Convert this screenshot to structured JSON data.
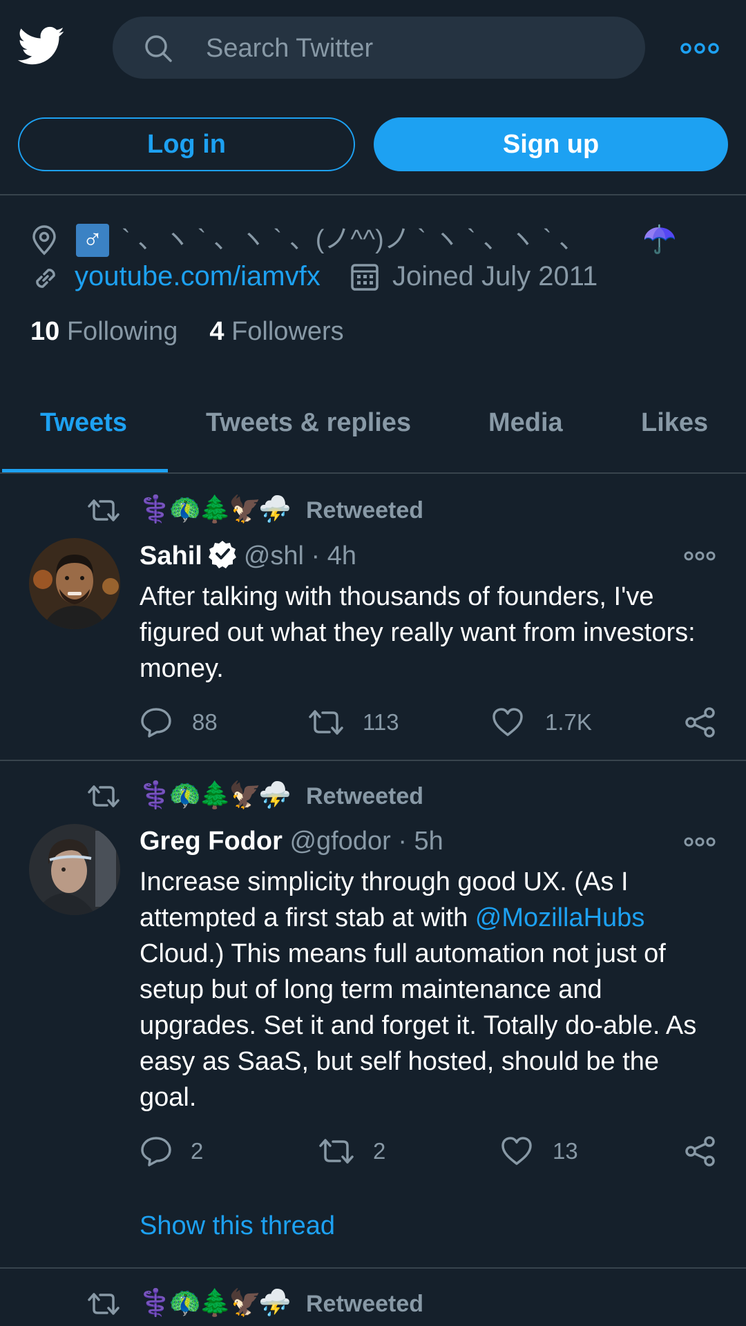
{
  "topbar": {
    "search_placeholder": "Search Twitter",
    "login_label": "Log in",
    "signup_label": "Sign up"
  },
  "profile": {
    "bio_text": "` 、ヽ ` 、ヽ ` 、(ノ^^)ノ ` ヽ ` 、ヽ ` 、",
    "male_symbol": "♂",
    "umbrella": "☂️",
    "url": "youtube.com/iamvfx",
    "joined": "Joined July 2011",
    "following_count": "10",
    "following_label": "Following",
    "followers_count": "4",
    "followers_label": "Followers"
  },
  "tabs": [
    "Tweets",
    "Tweets & replies",
    "Media",
    "Likes"
  ],
  "tweets": [
    {
      "retweeter_emojis": "⚕️🦚🌲🦅⛈️",
      "retweeted_label": "Retweeted",
      "name": "Sahil",
      "handle_time": "@shl · 4h",
      "text": "After talking with thousands of founders, I've figured out what they really want from investors: money.",
      "replies": "88",
      "retweets": "113",
      "likes": "1.7K"
    },
    {
      "retweeter_emojis": "⚕️🦚🌲🦅⛈️",
      "retweeted_label": "Retweeted",
      "name": "Greg Fodor",
      "handle_time": "@gfodor · 5h",
      "text_before": "Increase simplicity through good UX. (As I attempted a first stab at with ",
      "mention": "@MozillaHubs",
      "text_after": " Cloud.) This means full automation not just of setup but of long term maintenance and upgrades. Set it and forget it. Totally do-able. As easy as SaaS, but self hosted, should be the goal.",
      "replies": "2",
      "retweets": "2",
      "likes": "13",
      "show_thread": "Show this thread"
    },
    {
      "retweeter_emojis": "⚕️🦚🌲🦅⛈️",
      "retweeted_label": "Retweeted"
    }
  ],
  "colors": {
    "background": "#15202b",
    "accent": "#1da1f2",
    "secondary_text": "#8899a6",
    "divider": "#38444d"
  }
}
